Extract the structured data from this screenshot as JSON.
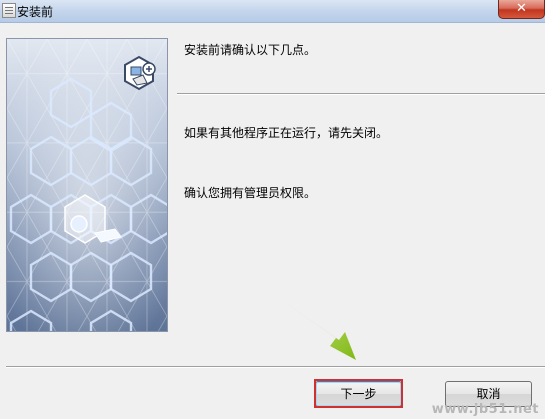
{
  "window": {
    "title": "安装前",
    "close_label": "✕",
    "close_color": "#c1361f"
  },
  "messages": {
    "intro": "安装前请确认以下几点。",
    "close_programs": "如果有其他程序正在运行，请先关闭。",
    "admin_rights": "确认您拥有管理员权限。"
  },
  "buttons": {
    "next_label": "下一步",
    "cancel_label": "取消"
  },
  "annotations": {
    "arrow_color": "#8ac51c",
    "highlight_color": "#d03030"
  },
  "watermark": {
    "text": "www.jb51.net"
  }
}
